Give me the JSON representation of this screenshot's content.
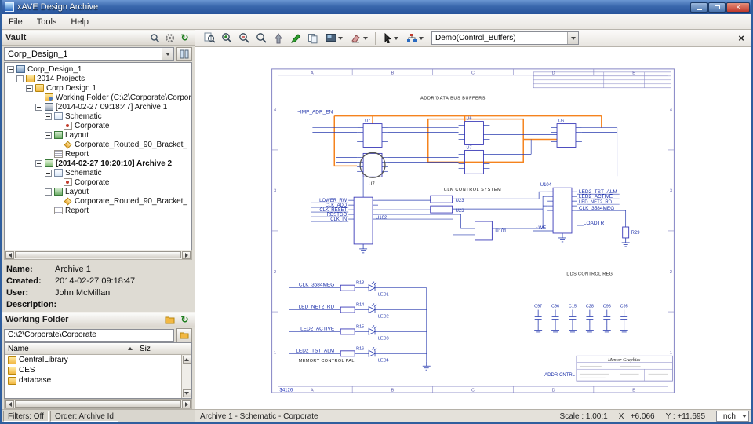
{
  "window": {
    "title": "xAVE Design Archive",
    "menu": [
      "File",
      "Tools",
      "Help"
    ]
  },
  "vault": {
    "title": "Vault",
    "design_combo": "Corp_Design_1",
    "tree": [
      {
        "label": "Corp_Design_1"
      },
      {
        "label": "2014 Projects"
      },
      {
        "label": "Corp Design 1"
      },
      {
        "label": "Working Folder (C:\\2\\Corporate\\Corpora"
      },
      {
        "label": "[2014-02-27 09:18:47] Archive 1"
      },
      {
        "label": "Schematic"
      },
      {
        "label": "Corporate"
      },
      {
        "label": "Layout"
      },
      {
        "label": "Corporate_Routed_90_Bracket_"
      },
      {
        "label": "Report"
      },
      {
        "label": "[2014-02-27 10:20:10] Archive 2"
      },
      {
        "label": "Schematic"
      },
      {
        "label": "Corporate"
      },
      {
        "label": "Layout"
      },
      {
        "label": "Corporate_Routed_90_Bracket_"
      },
      {
        "label": "Report"
      }
    ],
    "info": {
      "name_label": "Name:",
      "name_value": "Archive 1",
      "created_label": "Created:",
      "created_value": "2014-02-27 09:18:47",
      "user_label": "User:",
      "user_value": "John McMillan",
      "description_label": "Description:"
    }
  },
  "working_folder": {
    "title": "Working Folder",
    "path": "C:\\2\\Corporate\\Corporate",
    "col_name": "Name",
    "col_size": "Siz",
    "items": [
      {
        "name": "CentralLibrary"
      },
      {
        "name": "CES"
      },
      {
        "name": "database"
      }
    ]
  },
  "left_status": {
    "filters": "Filters: Off",
    "order": "Order: Archive Id"
  },
  "viewer": {
    "sheet_combo": "Demo(Control_Buffers)",
    "status_text": "Archive 1 - Schematic - Corporate",
    "scale": "Scale : 1.00:1",
    "x": "X : +6.066",
    "y": "Y : +11.695",
    "unit": "Inch"
  },
  "schematic": {
    "sheet_code": "$4126",
    "section_addr": "ADDR/DATA BUS BUFFERS",
    "section_clk": "CLK CONTROL SYSTEM",
    "section_mem": "MEMORY CONTROL PAL",
    "section_dds": "DDS CONTROL REG",
    "imp_adr_en": "~IMP_ADR_EN",
    "we": "~WE",
    "u7": "U7",
    "u6": "U6",
    "u102": "U102",
    "u23": "U23",
    "u101": "U101",
    "u104": "U104",
    "r29": "R29",
    "left_nets": [
      "LOWER_RW",
      "CLK_ADD",
      "CLK_RESET",
      "RDSTGO",
      "CLK_IN"
    ],
    "right_nets": [
      "LED2_TST_ALM",
      "LED2_ACTIVE",
      "LED_NET2_RD",
      "CLK_3584MEG",
      "LOADTR"
    ],
    "led_rows": [
      {
        "net": "CLK_3584MEG",
        "res": "R13",
        "led": "LED1"
      },
      {
        "net": "LED_NET2_RD",
        "res": "R14",
        "led": "LED2"
      },
      {
        "net": "LED2_ACTIVE",
        "res": "R15",
        "led": "LED3"
      },
      {
        "net": "LED2_TST_ALM",
        "res": "R16",
        "led": "LED4"
      }
    ],
    "caps": [
      "C97",
      "C96",
      "C15",
      "C28",
      "C98",
      "C95"
    ],
    "titleblock": "Mentor Graphics",
    "drawing_name": "ADDR-CNTRL",
    "cols": [
      "A",
      "B",
      "C",
      "D",
      "E"
    ],
    "rows": [
      "4",
      "3",
      "2",
      "1"
    ]
  }
}
